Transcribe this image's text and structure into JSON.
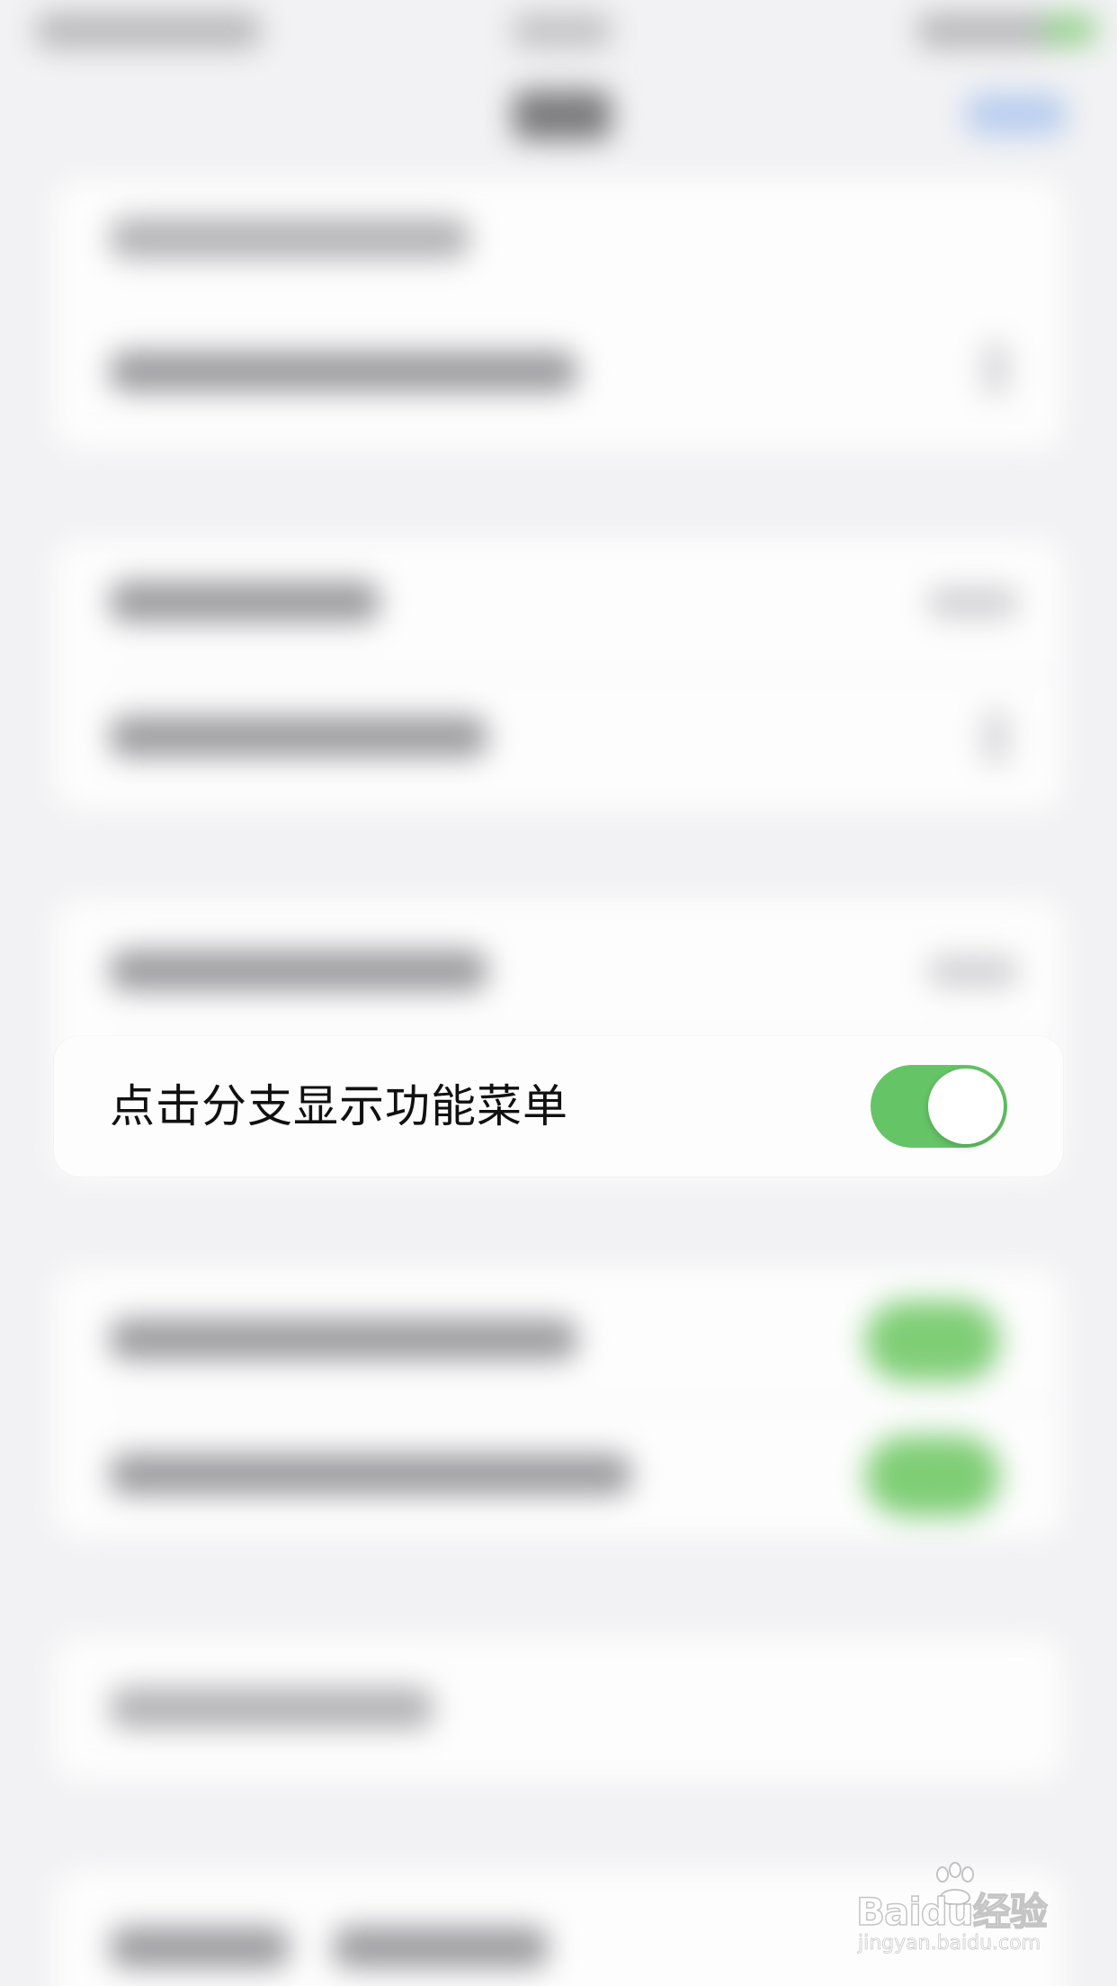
{
  "setting_row": {
    "label": "点击分支显示功能菜单",
    "toggle_on": true,
    "toggle_color": "#65c466"
  },
  "watermark": {
    "logo": "Baidu经验",
    "url": "jingyan.baidu.com"
  },
  "colors": {
    "background": "#f2f2f4",
    "card": "#fdfdfd",
    "accent_green": "#65c466"
  }
}
